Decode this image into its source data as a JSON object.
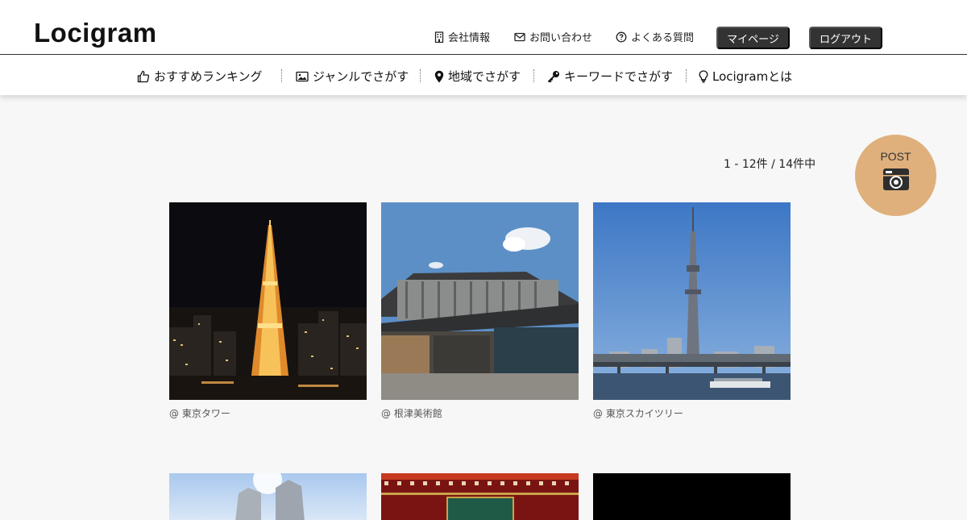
{
  "header": {
    "logo": "Locigram",
    "links": {
      "company": "会社情報",
      "contact": "お問い合わせ",
      "faq": "よくある質問"
    },
    "mypage": "マイページ",
    "logout": "ログアウト"
  },
  "nav": {
    "ranking": "おすすめランキング",
    "genre": "ジャンルでさがす",
    "region": "地域でさがす",
    "keyword": "キーワードでさがす",
    "about": "Locigramとは"
  },
  "post": {
    "label": "POST",
    "icon": "camera-icon"
  },
  "results": {
    "count": "1 - 12件 / 14件中"
  },
  "cards": [
    {
      "caption": "@ 東京タワー"
    },
    {
      "caption": "@ 根津美術館"
    },
    {
      "caption": "@ 東京スカイツリー"
    }
  ],
  "colors": {
    "post_bg": "#dfb07c",
    "dark_button": "#333333",
    "page_bg": "#f7f7f7"
  }
}
